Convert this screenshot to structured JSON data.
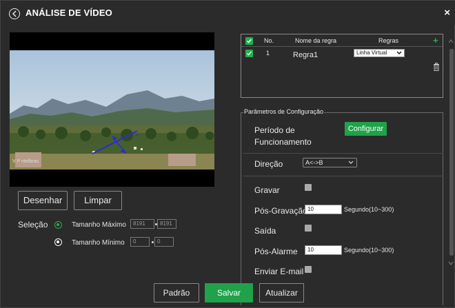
{
  "header": {
    "title": "ANÁLISE DE VÍDEO",
    "close_symbol": "×"
  },
  "video": {
    "watermark": "V P  ntelbras"
  },
  "draw_buttons": {
    "draw": "Desenhar",
    "clear": "Limpar"
  },
  "selection": {
    "label": "Seleção",
    "max_label": "Tamanho Máximo",
    "min_label": "Tamanho Mínimo",
    "max_w": "8191",
    "max_h": "8191",
    "min_w": "0",
    "min_h": "0"
  },
  "rules_table": {
    "headers": {
      "no": "No.",
      "name": "Nome da regra",
      "rules": "Regras"
    },
    "rows": [
      {
        "no": "1",
        "name": "Regra1",
        "rule_type": "Linha Virtual"
      }
    ]
  },
  "config": {
    "legend": "Parâmetros de Configuração",
    "period_label_1": "Período de",
    "period_label_2": "Funcionamento",
    "configure_button": "Configurar",
    "direction_label": "Direção",
    "direction_value": "A<->B",
    "record_label": "Gravar",
    "post_record_label": "Pós-Gravação",
    "post_record_value": "10",
    "post_record_range": "Segundo(10~300)",
    "output_label": "Saída",
    "post_alarm_label": "Pós-Alarme",
    "post_alarm_value": "10",
    "post_alarm_range": "Segundo(10~300)",
    "email_label": "Enviar E-mail"
  },
  "footer": {
    "default": "Padrão",
    "save": "Salvar",
    "refresh": "Atualizar"
  },
  "colors": {
    "accent": "#23b14d",
    "background": "#2b2b2b"
  }
}
